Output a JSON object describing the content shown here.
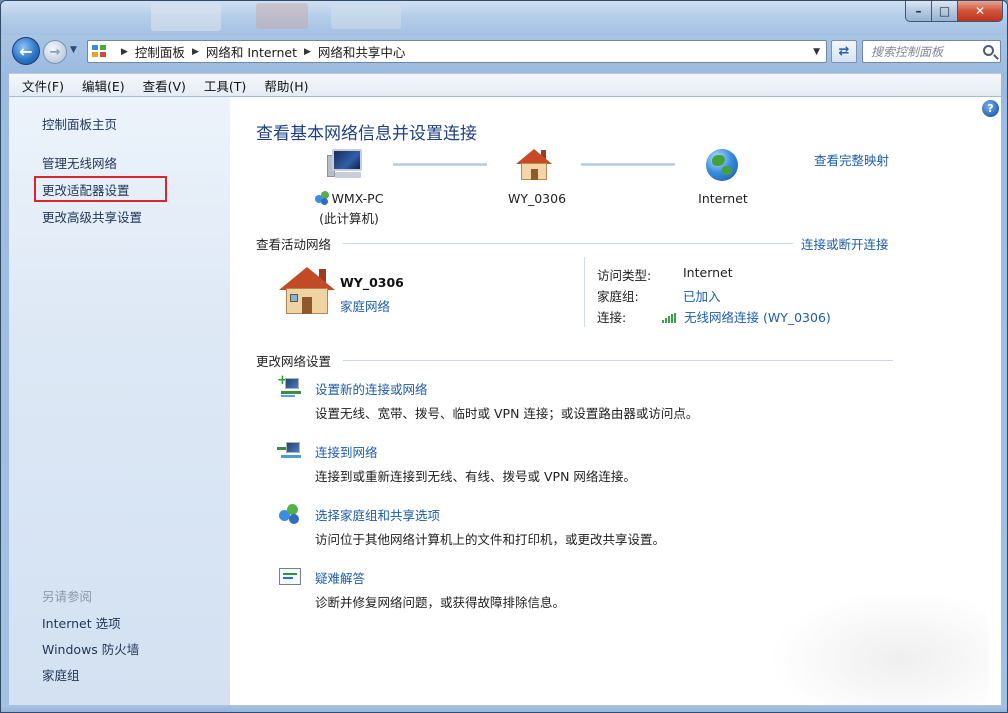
{
  "window": {
    "minimize_symbol": "–",
    "maximize_symbol": "□",
    "close_symbol": "✕"
  },
  "nav": {
    "breadcrumbs": [
      "控制面板",
      "网络和 Internet",
      "网络和共享中心"
    ],
    "search_placeholder": "搜索控制面板"
  },
  "menu": [
    "文件(F)",
    "编辑(E)",
    "查看(V)",
    "工具(T)",
    "帮助(H)"
  ],
  "sidebar": {
    "home": "控制面板主页",
    "links": [
      "管理无线网络",
      "更改适配器设置",
      "更改高级共享设置"
    ],
    "see_also_title": "另请参阅",
    "see_also": [
      "Internet 选项",
      "Windows 防火墙",
      "家庭组"
    ]
  },
  "main": {
    "title": "查看基本网络信息并设置连接",
    "view_full_map": "查看完整映射",
    "map": {
      "computer_name": "WMX-PC",
      "computer_sub": "(此计算机)",
      "network_name": "WY_0306",
      "internet": "Internet"
    },
    "active": {
      "heading": "查看活动网络",
      "connect_link": "连接或断开连接",
      "name": "WY_0306",
      "type": "家庭网络",
      "access_label": "访问类型:",
      "access_value": "Internet",
      "homegroup_label": "家庭组:",
      "homegroup_value": "已加入",
      "connection_label": "连接:",
      "connection_value": "无线网络连接 (WY_0306)"
    },
    "change": {
      "heading": "更改网络设置",
      "tasks": [
        {
          "icon": "new-connection-icon",
          "title": "设置新的连接或网络",
          "desc": "设置无线、宽带、拨号、临时或 VPN 连接；或设置路由器或访问点。"
        },
        {
          "icon": "connect-network-icon",
          "title": "连接到网络",
          "desc": "连接到或重新连接到无线、有线、拨号或 VPN 网络连接。"
        },
        {
          "icon": "homegroup-icon",
          "title": "选择家庭组和共享选项",
          "desc": "访问位于其他网络计算机上的文件和打印机，或更改共享设置。"
        },
        {
          "icon": "troubleshoot-icon",
          "title": "疑难解答",
          "desc": "诊断并修复网络问题，或获得故障排除信息。"
        }
      ]
    }
  }
}
